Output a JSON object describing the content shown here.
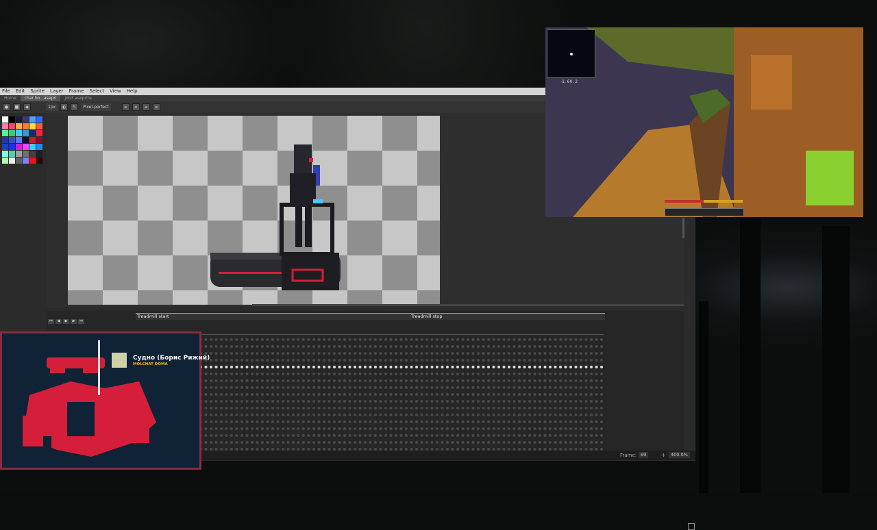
{
  "aseprite": {
    "menu": [
      "File",
      "Edit",
      "Sprite",
      "Layer",
      "Frame",
      "Select",
      "View",
      "Help"
    ],
    "tabs": [
      {
        "label": "Home",
        "active": false
      },
      {
        "label": "char bo...asepri",
        "active": true
      },
      {
        "label": "job3.aseprite",
        "active": false
      }
    ],
    "toolbar": {
      "brush_size": "1px",
      "pixel_perfect_label": "Pixel-perfect"
    },
    "palette": [
      "#ffffff",
      "#000000",
      "#1b1b3a",
      "#3b3b6b",
      "#4fa3ff",
      "#2f6cff",
      "#ff7aa8",
      "#ff3f6e",
      "#ffb04a",
      "#ff7a2a",
      "#ffd84a",
      "#ff5a3a",
      "#4aff9a",
      "#2fd07a",
      "#47c9ff",
      "#2f9bd0",
      "#1a2a6e",
      "#ff2040",
      "#1e3aa0",
      "#3050d0",
      "#5a78ff",
      "#101030",
      "#c02030",
      "#801020",
      "#2040c0",
      "#1830ff",
      "#d020d0",
      "#ff40ff",
      "#3ad0ff",
      "#1a8aff",
      "#80ffe0",
      "#50d0b0",
      "#a0a0a0",
      "#707070",
      "#404040",
      "#202020",
      "#b0ffb0",
      "#f0f0f0",
      "#606060",
      "#8080ff",
      "#ff1010",
      "#300000"
    ]
  },
  "timeline": {
    "tags": [
      {
        "label": "Treadmill start"
      },
      {
        "label": "Treadmill stop"
      }
    ],
    "play_controls": [
      "⏮",
      "◀",
      "▶",
      "▶",
      "⏭"
    ]
  },
  "status": {
    "frame_label": "Frame:",
    "frame_value": "69",
    "zoom": "400.0%"
  },
  "minecraft": {
    "coords": "-1, 60, 2"
  },
  "now_playing": {
    "title": "Судно (Борис Рижий)",
    "artist": "MOLCHAT DOMA"
  },
  "colors": {
    "overlay_border": "#8a2a40",
    "overlay_bg": "#0f2236",
    "accent_red": "#d41e3a",
    "artist_yellow": "#f2b824"
  }
}
